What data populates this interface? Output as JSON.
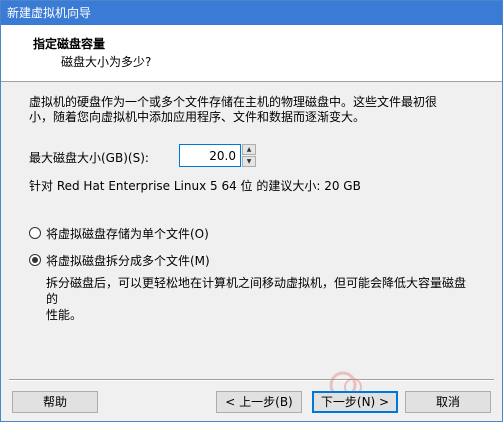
{
  "window": {
    "title": "新建虚拟机向导"
  },
  "header": {
    "title": "指定磁盘容量",
    "subtitle": "磁盘大小为多少?"
  },
  "description": {
    "line1": "虚拟机的硬盘作为一个或多个文件存储在主机的物理磁盘中。这些文件最初很",
    "line2": "小，随着您向虚拟机中添加应用程序、文件和数据而逐渐变大。"
  },
  "disk_size": {
    "label": "最大磁盘大小(GB)(S):",
    "value": "20.0"
  },
  "recommendation": {
    "text": "针对 Red Hat Enterprise Linux 5 64 位 的建议大小: 20 GB"
  },
  "options": {
    "single_file_label": "将虚拟磁盘存储为单个文件(O)",
    "multiple_files_label": "将虚拟磁盘拆分成多个文件(M)",
    "selected": "multiple_files",
    "split_desc_line1": "拆分磁盘后，可以更轻松地在计算机之间移动虚拟机，但可能会降低大容量磁盘的",
    "split_desc_line2": "性能。"
  },
  "buttons": {
    "help": "帮助",
    "back": "< 上一步(B)",
    "next": "下一步(N) >",
    "cancel": "取消"
  },
  "colors": {
    "titlebar": "#3a7bd5",
    "header_bg": "#ffffff",
    "dialog_bg": "#f0f0f0",
    "focus_border": "#0078d7"
  }
}
